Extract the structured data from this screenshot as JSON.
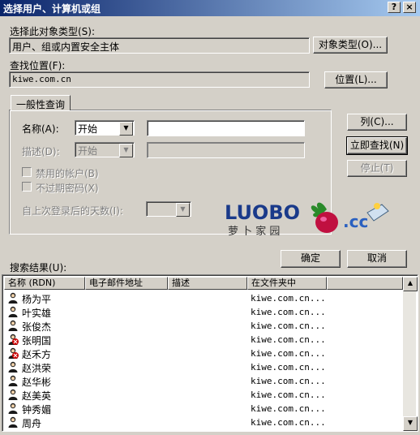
{
  "window": {
    "title": "选择用户、计算机或组",
    "help": "?",
    "close": "×"
  },
  "object_type": {
    "label": "选择此对象类型(S):",
    "value": "用户、组或内置安全主体",
    "button": "对象类型(O)..."
  },
  "location": {
    "label": "查找位置(F):",
    "value": "kiwe.com.cn",
    "button": "位置(L)..."
  },
  "query": {
    "tab": "一般性查询",
    "name_label": "名称(A):",
    "name_mode": "开始",
    "name_value": "",
    "desc_label": "描述(D):",
    "desc_mode": "开始",
    "desc_value": "",
    "disabled_accounts": "禁用的帐户(B)",
    "no_expire_pwd": "不过期密码(X)",
    "days_label": "自上次登录后的天数(I):",
    "days_value": ""
  },
  "side_buttons": {
    "columns": "列(C)...",
    "find_now": "立即查找(N)",
    "stop": "停止(T)"
  },
  "watermark": {
    "brand": "LUOBO",
    "subtitle": "萝卜家园",
    "suffix": ".cc"
  },
  "footer": {
    "ok": "确定",
    "cancel": "取消"
  },
  "results": {
    "label": "搜索结果(U):",
    "columns": [
      "名称 (RDN)",
      "电子邮件地址",
      "描述",
      "在文件夹中"
    ],
    "rows": [
      {
        "name": "杨为平",
        "folder": "kiwe.com.cn...",
        "disabled": false
      },
      {
        "name": "叶实雄",
        "folder": "kiwe.com.cn...",
        "disabled": false
      },
      {
        "name": "张俊杰",
        "folder": "kiwe.com.cn...",
        "disabled": false
      },
      {
        "name": "张明国",
        "folder": "kiwe.com.cn...",
        "disabled": true
      },
      {
        "name": "赵禾方",
        "folder": "kiwe.com.cn...",
        "disabled": true
      },
      {
        "name": "赵洪荣",
        "folder": "kiwe.com.cn...",
        "disabled": false
      },
      {
        "name": "赵华彬",
        "folder": "kiwe.com.cn...",
        "disabled": false
      },
      {
        "name": "赵美英",
        "folder": "kiwe.com.cn...",
        "disabled": false
      },
      {
        "name": "钟秀媚",
        "folder": "kiwe.com.cn...",
        "disabled": false
      },
      {
        "name": "周舟",
        "folder": "kiwe.com.cn...",
        "disabled": false
      }
    ]
  },
  "colors": {
    "title_start": "#0a246a",
    "title_end": "#a6caf0",
    "face": "#d4d0c8",
    "disabled_badge": "#cc0000"
  }
}
